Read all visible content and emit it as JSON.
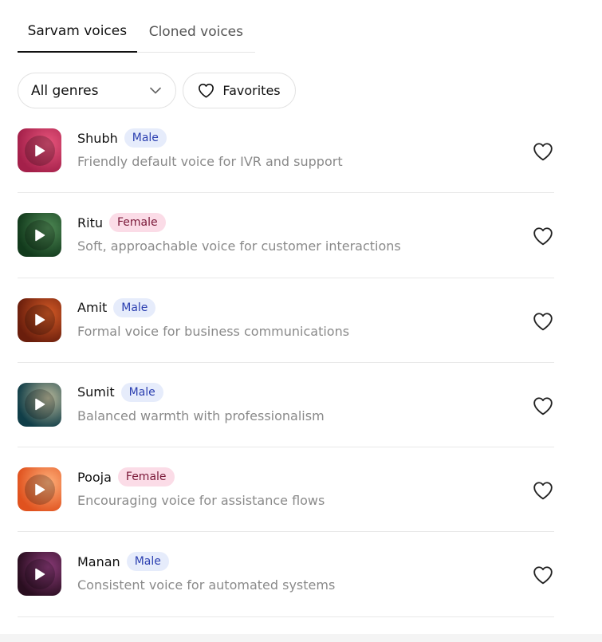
{
  "tabs": [
    {
      "label": "Sarvam voices",
      "active": true
    },
    {
      "label": "Cloned voices",
      "active": false
    }
  ],
  "filters": {
    "genre_label": "All genres",
    "favorites_label": "Favorites"
  },
  "voices": [
    {
      "name": "Shubh",
      "gender": "Male",
      "description": "Friendly default voice for IVR and support",
      "colors": [
        "#a4204a",
        "#e8557c"
      ]
    },
    {
      "name": "Ritu",
      "gender": "Female",
      "description": "Soft, approachable voice for customer interactions",
      "colors": [
        "#123a1c",
        "#4f8a55"
      ]
    },
    {
      "name": "Amit",
      "gender": "Male",
      "description": "Formal voice for business communications",
      "colors": [
        "#6a1e0c",
        "#d45a26"
      ]
    },
    {
      "name": "Sumit",
      "gender": "Male",
      "description": "Balanced warmth with professionalism",
      "colors": [
        "#103e48",
        "#b8b89a"
      ]
    },
    {
      "name": "Pooja",
      "gender": "Female",
      "description": "Encouraging voice for assistance flows",
      "colors": [
        "#e0521e",
        "#ffb07a"
      ]
    },
    {
      "name": "Manan",
      "gender": "Male",
      "description": "Consistent voice for automated systems",
      "colors": [
        "#2a0e20",
        "#8a3a78"
      ]
    }
  ]
}
